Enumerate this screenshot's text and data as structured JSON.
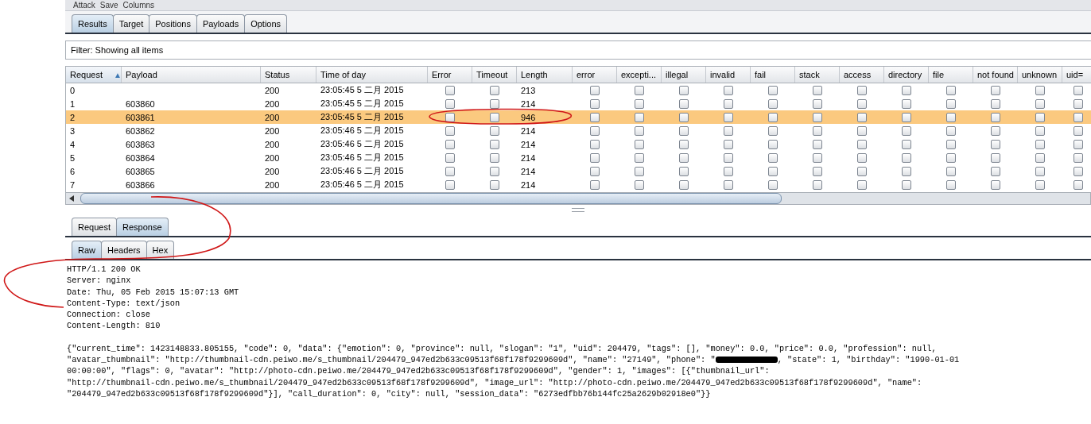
{
  "menu": [
    "Attack",
    "Save",
    "Columns"
  ],
  "tabs": [
    {
      "label": "Results",
      "selected": true
    },
    {
      "label": "Target",
      "selected": false
    },
    {
      "label": "Positions",
      "selected": false
    },
    {
      "label": "Payloads",
      "selected": false
    },
    {
      "label": "Options",
      "selected": false
    }
  ],
  "filter": "Filter:  Showing all items",
  "table": {
    "columns": [
      {
        "label": "Request",
        "sorted": true,
        "sort_icon": "▲"
      },
      {
        "label": "Payload",
        "sorted": false
      },
      {
        "label": "Status",
        "sorted": false
      },
      {
        "label": "Time of day",
        "sorted": false
      },
      {
        "label": "Error",
        "sorted": false
      },
      {
        "label": "Timeout",
        "sorted": false
      },
      {
        "label": "Length",
        "sorted": false
      },
      {
        "label": "error",
        "sorted": false
      },
      {
        "label": "excepti...",
        "sorted": false
      },
      {
        "label": "illegal",
        "sorted": false
      },
      {
        "label": "invalid",
        "sorted": false
      },
      {
        "label": "fail",
        "sorted": false
      },
      {
        "label": "stack",
        "sorted": false
      },
      {
        "label": "access",
        "sorted": false
      },
      {
        "label": "directory",
        "sorted": false
      },
      {
        "label": "file",
        "sorted": false
      },
      {
        "label": "not found",
        "sorted": false
      },
      {
        "label": "unknown",
        "sorted": false
      },
      {
        "label": "uid=",
        "sorted": false
      }
    ],
    "rows": [
      {
        "request": "0",
        "payload": "",
        "status": "200",
        "time": "23:05:45 5 二月 2015",
        "error": false,
        "timeout": false,
        "length": "213",
        "matches": [
          false,
          false,
          false,
          false,
          false,
          false,
          false,
          false,
          false,
          false,
          false,
          false
        ],
        "selected": false
      },
      {
        "request": "1",
        "payload": "603860",
        "status": "200",
        "time": "23:05:45 5 二月 2015",
        "error": false,
        "timeout": false,
        "length": "214",
        "matches": [
          false,
          false,
          false,
          false,
          false,
          false,
          false,
          false,
          false,
          false,
          false,
          false
        ],
        "selected": false
      },
      {
        "request": "2",
        "payload": "603861",
        "status": "200",
        "time": "23:05:45 5 二月 2015",
        "error": false,
        "timeout": false,
        "length": "946",
        "matches": [
          false,
          false,
          false,
          false,
          false,
          false,
          false,
          false,
          false,
          false,
          false,
          false
        ],
        "selected": true
      },
      {
        "request": "3",
        "payload": "603862",
        "status": "200",
        "time": "23:05:46 5 二月 2015",
        "error": false,
        "timeout": false,
        "length": "214",
        "matches": [
          false,
          false,
          false,
          false,
          false,
          false,
          false,
          false,
          false,
          false,
          false,
          false
        ],
        "selected": false
      },
      {
        "request": "4",
        "payload": "603863",
        "status": "200",
        "time": "23:05:46 5 二月 2015",
        "error": false,
        "timeout": false,
        "length": "214",
        "matches": [
          false,
          false,
          false,
          false,
          false,
          false,
          false,
          false,
          false,
          false,
          false,
          false
        ],
        "selected": false
      },
      {
        "request": "5",
        "payload": "603864",
        "status": "200",
        "time": "23:05:46 5 二月 2015",
        "error": false,
        "timeout": false,
        "length": "214",
        "matches": [
          false,
          false,
          false,
          false,
          false,
          false,
          false,
          false,
          false,
          false,
          false,
          false
        ],
        "selected": false
      },
      {
        "request": "6",
        "payload": "603865",
        "status": "200",
        "time": "23:05:46 5 二月 2015",
        "error": false,
        "timeout": false,
        "length": "214",
        "matches": [
          false,
          false,
          false,
          false,
          false,
          false,
          false,
          false,
          false,
          false,
          false,
          false
        ],
        "selected": false
      },
      {
        "request": "7",
        "payload": "603866",
        "status": "200",
        "time": "23:05:46 5 二月 2015",
        "error": false,
        "timeout": false,
        "length": "214",
        "matches": [
          false,
          false,
          false,
          false,
          false,
          false,
          false,
          false,
          false,
          false,
          false,
          false
        ],
        "selected": false
      }
    ]
  },
  "message_tabs": [
    {
      "label": "Request",
      "selected": false
    },
    {
      "label": "Response",
      "selected": true
    }
  ],
  "view_tabs": [
    {
      "label": "Raw",
      "selected": true
    },
    {
      "label": "Headers",
      "selected": false
    },
    {
      "label": "Hex",
      "selected": false
    }
  ],
  "response": {
    "headers": [
      "HTTP/1.1 200 OK",
      "Server: nginx",
      "Date: Thu, 05 Feb 2015 15:07:13 GMT",
      "Content-Type: text/json",
      "Connection: close",
      "Content-Length: 810"
    ],
    "body": [
      {
        "text": "{\"current_time\": 1423148833.805155, \"code\": 0, \"data\": {\"emotion\": 0, \"province\": null, \"slogan\": \"1\", \"uid\": 204479, \"tags\": [], \"money\": 0.0, \"price\": 0.0, \"profession\": null,",
        "redacted": false
      },
      {
        "text": "\"avatar_thumbnail\": \"http://thumbnail-cdn.peiwo.me/s_thumbnail/204479_947ed2b633c09513f68f178f9299609d\", \"name\": \"27149\", \"phone\": \"",
        "redacted": true,
        "after": ", \"state\": 1, \"birthday\": \"1990-01-01"
      },
      {
        "text": "00:00:00\", \"flags\": 0, \"avatar\": \"http://photo-cdn.peiwo.me/204479_947ed2b633c09513f68f178f9299609d\", \"gender\": 1, \"images\": [{\"thumbnail_url\":",
        "redacted": false
      },
      {
        "text": "\"http://thumbnail-cdn.peiwo.me/s_thumbnail/204479_947ed2b633c09513f68f178f9299609d\", \"image_url\": \"http://photo-cdn.peiwo.me/204479_947ed2b633c09513f68f178f9299609d\", \"name\":",
        "redacted": false
      },
      {
        "text": "\"204479_947ed2b633c09513f68f178f9299609d\"}], \"call_duration\": 0, \"city\": null, \"session_data\": \"6273edfbb76b144fc25a2629b02918e0\"}}",
        "redacted": false
      }
    ]
  }
}
